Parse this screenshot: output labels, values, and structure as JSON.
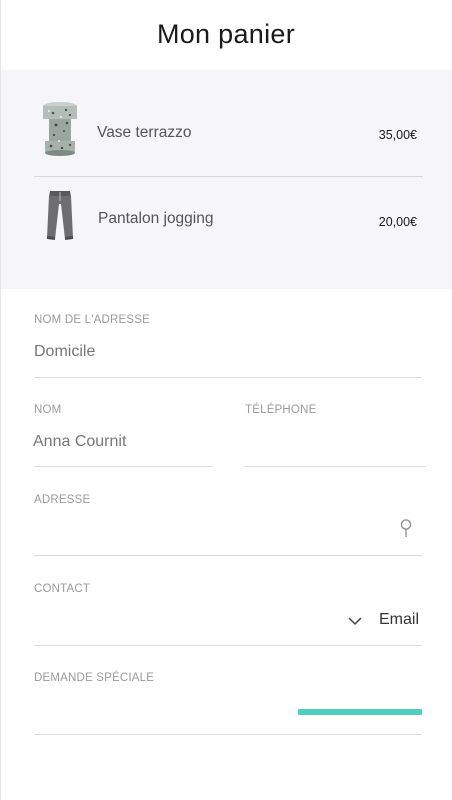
{
  "header": {
    "title": "Mon panier"
  },
  "cart": {
    "items": [
      {
        "name": "Vase terrazzo",
        "price": "35,00€",
        "icon": "terrazzo-vase-thumbnail"
      },
      {
        "name": "Pantalon jogging",
        "price": "20,00€",
        "icon": "jogging-pants-thumbnail"
      }
    ]
  },
  "form": {
    "address_name": {
      "label": "NOM DE L'ADRESSE",
      "value": "Domicile"
    },
    "name": {
      "label": "NOM",
      "value": "Anna Cournit"
    },
    "phone": {
      "label": "TÉLÉPHONE",
      "value": ""
    },
    "address": {
      "label": "ADRESSE",
      "value": "",
      "icon": "location-pin-icon"
    },
    "contact": {
      "label": "CONTACT",
      "value": "Email",
      "icon": "chevron-down-icon"
    },
    "special_request": {
      "label": "DEMANDE SPÉCIALE",
      "value": "",
      "accent_color": "#4ecdc4",
      "fill": 1.0
    }
  }
}
